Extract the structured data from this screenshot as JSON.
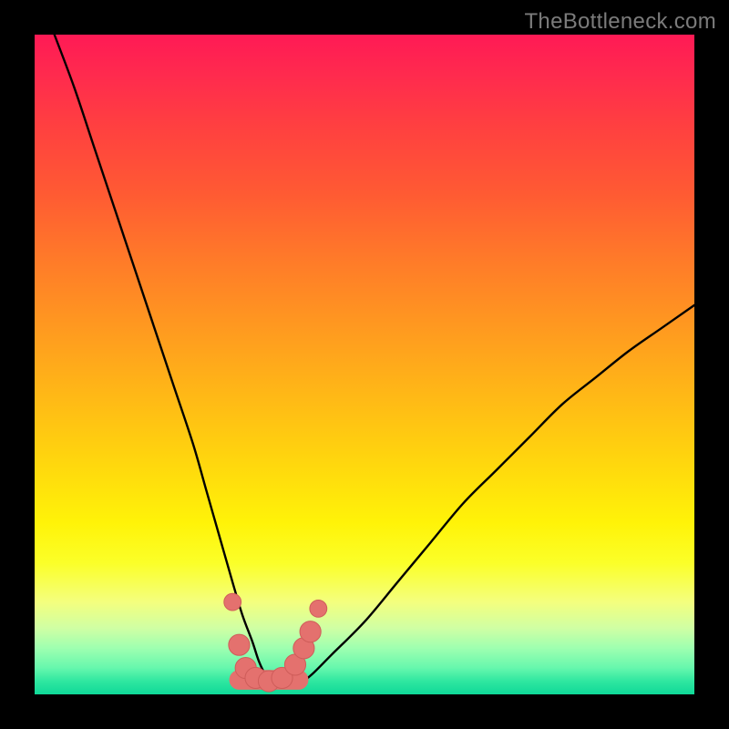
{
  "watermark": "TheBottleneck.com",
  "colors": {
    "frame": "#000000",
    "curve": "#000000",
    "marker_fill": "#e4716e",
    "marker_stroke": "#cf5d5a"
  },
  "chart_data": {
    "type": "line",
    "title": "",
    "xlabel": "",
    "ylabel": "",
    "xlim": [
      0,
      100
    ],
    "ylim": [
      0,
      100
    ],
    "grid": false,
    "legend": false,
    "series": [
      {
        "name": "bottleneck-curve",
        "x": [
          3,
          6,
          9,
          12,
          15,
          18,
          21,
          24,
          26,
          28,
          30,
          31.5,
          33,
          34,
          35,
          36.5,
          38,
          40,
          42,
          45,
          50,
          55,
          60,
          65,
          70,
          75,
          80,
          85,
          90,
          95,
          100
        ],
        "y": [
          100,
          92,
          83,
          74,
          65,
          56,
          47,
          38,
          31,
          24,
          17,
          12,
          8,
          5,
          3,
          1.5,
          1,
          1.5,
          3,
          6,
          11,
          17,
          23,
          29,
          34,
          39,
          44,
          48,
          52,
          55.5,
          59
        ]
      }
    ],
    "markers": [
      {
        "x": 30.0,
        "y": 14.0,
        "r": 1.3
      },
      {
        "x": 31.0,
        "y": 7.5,
        "r": 1.6
      },
      {
        "x": 32.0,
        "y": 4.0,
        "r": 1.6
      },
      {
        "x": 33.5,
        "y": 2.5,
        "r": 1.6
      },
      {
        "x": 35.5,
        "y": 2.0,
        "r": 1.6
      },
      {
        "x": 37.5,
        "y": 2.5,
        "r": 1.6
      },
      {
        "x": 39.5,
        "y": 4.5,
        "r": 1.6
      },
      {
        "x": 40.8,
        "y": 7.0,
        "r": 1.6
      },
      {
        "x": 41.8,
        "y": 9.5,
        "r": 1.6
      },
      {
        "x": 43.0,
        "y": 13.0,
        "r": 1.3
      }
    ],
    "floor_band": {
      "x_start": 31,
      "x_end": 40,
      "y": 2.2,
      "thickness": 3.0
    }
  }
}
